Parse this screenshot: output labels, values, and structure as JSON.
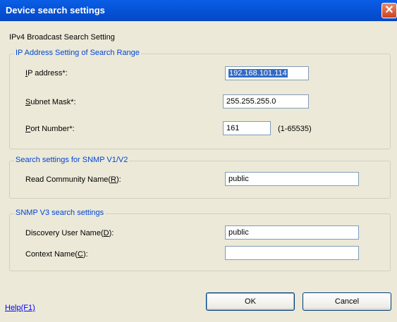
{
  "window": {
    "title": "Device search settings",
    "close_glyph": "✕"
  },
  "section_title": "IPv4 Broadcast Search Setting",
  "ip_group": {
    "legend": "IP Address Setting of Search Range",
    "ip_label_key": "I",
    "ip_label_rest": "P address*:",
    "ip_value": "192.168.101.114",
    "subnet_label_key": "S",
    "subnet_label_rest": "ubnet Mask*:",
    "subnet_value": "255.255.255.0",
    "port_label_key": "P",
    "port_label_rest": "ort Number*:",
    "port_value": "161",
    "port_hint": "(1-65535)"
  },
  "snmp_v12": {
    "legend": "Search settings for SNMP V1/V2",
    "community_label_pre": "Read Community Name(",
    "community_label_key": "R",
    "community_label_post": "):",
    "community_value": "public"
  },
  "snmp_v3": {
    "legend": "SNMP V3 search settings",
    "user_label_pre": "Discovery User Name(",
    "user_label_key": "D",
    "user_label_post": "):",
    "user_value": "public",
    "context_label_pre": "Context Name(",
    "context_label_key": "C",
    "context_label_post": "):",
    "context_value": ""
  },
  "footer": {
    "help_link": "Help(F1)",
    "ok_label": "OK",
    "cancel_label": "Cancel"
  }
}
